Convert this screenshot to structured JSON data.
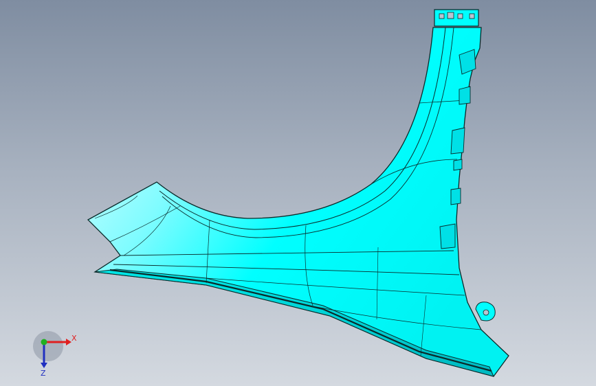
{
  "viewport": {
    "background_top": "#7f8da1",
    "background_bottom": "#d4d9e0"
  },
  "model": {
    "part": "fender-panel",
    "fill_color": "#00ffff",
    "highlight_color": "#e8ffff",
    "edge_color": "#0a2a2a"
  },
  "triad": {
    "x_label": "X",
    "z_label": "Z",
    "x_color": "#e02020",
    "y_color": "#20b020",
    "z_color": "#2030c0"
  }
}
